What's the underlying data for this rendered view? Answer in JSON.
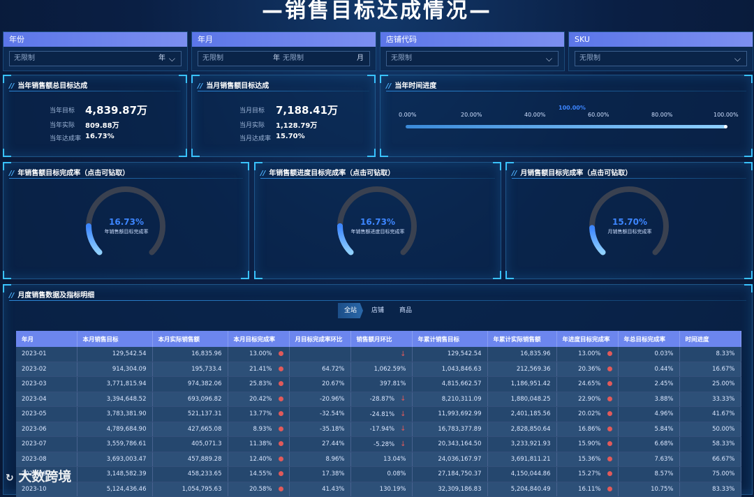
{
  "title": "—销售目标达成情况—",
  "filters": [
    {
      "label": "年份",
      "value": "无限制",
      "unit": "年"
    },
    {
      "label": "年月",
      "value": "无限制",
      "unit": "年",
      "value2": "无限制",
      "unit2": "月"
    },
    {
      "label": "店铺代码",
      "value": "无限制"
    },
    {
      "label": "SKU",
      "value": "无限制"
    }
  ],
  "kpi_year": {
    "title": "当年销售额总目标达成",
    "target_label": "当年目标",
    "target": "4,839.87万",
    "actual_label": "当年实际",
    "actual": "809.88万",
    "rate_label": "当年达成率",
    "rate": "16.73%"
  },
  "kpi_month": {
    "title": "当月销售额目标达成",
    "target_label": "当月目标",
    "target": "7,188.41万",
    "actual_label": "当月实际",
    "actual": "1,128.79万",
    "rate_label": "当月达成率",
    "rate": "15.70%"
  },
  "time_progress": {
    "title": "当年时间进度",
    "value": "100.00%",
    "value_fraction": 1.0,
    "ticks": [
      "0.00%",
      "20.00%",
      "40.00%",
      "60.00%",
      "80.00%",
      "100.00%"
    ]
  },
  "gauges": [
    {
      "title": "年销售额目标完成率（点击可钻取）",
      "value": "16.73%",
      "fraction": 0.1673,
      "caption": "年销售额目标完成率"
    },
    {
      "title": "年销售额进度目标完成率（点击可钻取）",
      "value": "16.73%",
      "fraction": 0.1673,
      "caption": "年销售额进度目标完成率"
    },
    {
      "title": "月销售额目标完成率（点击可钻取）",
      "value": "15.70%",
      "fraction": 0.157,
      "caption": "月销售额目标完成率"
    }
  ],
  "detail": {
    "title": "月度销售数据及指标明细",
    "tabs": [
      "全站",
      "店铺",
      "商品"
    ],
    "columns": [
      "年月",
      "本月销售目标",
      "本月实际销售额",
      "本月目标完成率",
      "月目标完成率环比",
      "销售额月环比",
      "年累计销售目标",
      "年累计实际销售额",
      "年进度目标完成率",
      "年总目标完成率",
      "时间进度"
    ],
    "rows": [
      {
        "ym": "2023-01",
        "target": "129,542.54",
        "actual": "16,835.96",
        "rate": "13.00%",
        "rate_mom": "",
        "sales_mom": "",
        "sales_down": true,
        "cum_target": "129,542.54",
        "cum_actual": "16,835.96",
        "prog_rate": "13.00%",
        "total_rate": "0.03%",
        "time": "8.33%"
      },
      {
        "ym": "2023-02",
        "target": "914,304.09",
        "actual": "195,733.4",
        "rate": "21.41%",
        "rate_mom": "64.72%",
        "sales_mom": "1,062.59%",
        "sales_down": false,
        "cum_target": "1,043,846.63",
        "cum_actual": "212,569.36",
        "prog_rate": "20.36%",
        "total_rate": "0.44%",
        "time": "16.67%"
      },
      {
        "ym": "2023-03",
        "target": "3,771,815.94",
        "actual": "974,382.06",
        "rate": "25.83%",
        "rate_mom": "20.67%",
        "sales_mom": "397.81%",
        "sales_down": false,
        "cum_target": "4,815,662.57",
        "cum_actual": "1,186,951.42",
        "prog_rate": "24.65%",
        "total_rate": "2.45%",
        "time": "25.00%"
      },
      {
        "ym": "2023-04",
        "target": "3,394,648.52",
        "actual": "693,096.82",
        "rate": "20.42%",
        "rate_mom": "-20.96%",
        "sales_mom": "-28.87%",
        "sales_down": true,
        "cum_target": "8,210,311.09",
        "cum_actual": "1,880,048.25",
        "prog_rate": "22.90%",
        "total_rate": "3.88%",
        "time": "33.33%"
      },
      {
        "ym": "2023-05",
        "target": "3,783,381.90",
        "actual": "521,137.31",
        "rate": "13.77%",
        "rate_mom": "-32.54%",
        "sales_mom": "-24.81%",
        "sales_down": true,
        "cum_target": "11,993,692.99",
        "cum_actual": "2,401,185.56",
        "prog_rate": "20.02%",
        "total_rate": "4.96%",
        "time": "41.67%"
      },
      {
        "ym": "2023-06",
        "target": "4,789,684.90",
        "actual": "427,665.08",
        "rate": "8.93%",
        "rate_mom": "-35.18%",
        "sales_mom": "-17.94%",
        "sales_down": true,
        "cum_target": "16,783,377.89",
        "cum_actual": "2,828,850.64",
        "prog_rate": "16.86%",
        "total_rate": "5.84%",
        "time": "50.00%"
      },
      {
        "ym": "2023-07",
        "target": "3,559,786.61",
        "actual": "405,071.3",
        "rate": "11.38%",
        "rate_mom": "27.44%",
        "sales_mom": "-5.28%",
        "sales_down": true,
        "cum_target": "20,343,164.50",
        "cum_actual": "3,233,921.93",
        "prog_rate": "15.90%",
        "total_rate": "6.68%",
        "time": "58.33%"
      },
      {
        "ym": "2023-08",
        "target": "3,693,003.47",
        "actual": "457,889.28",
        "rate": "12.40%",
        "rate_mom": "8.96%",
        "sales_mom": "13.04%",
        "sales_down": false,
        "cum_target": "24,036,167.97",
        "cum_actual": "3,691,811.21",
        "prog_rate": "15.36%",
        "total_rate": "7.63%",
        "time": "66.67%"
      },
      {
        "ym": "2023-09",
        "target": "3,148,582.39",
        "actual": "458,233.65",
        "rate": "14.55%",
        "rate_mom": "17.38%",
        "sales_mom": "0.08%",
        "sales_down": false,
        "cum_target": "27,184,750.37",
        "cum_actual": "4,150,044.86",
        "prog_rate": "15.27%",
        "total_rate": "8.57%",
        "time": "75.00%"
      },
      {
        "ym": "2023-10",
        "target": "5,124,436.46",
        "actual": "1,054,795.63",
        "rate": "20.58%",
        "rate_mom": "41.43%",
        "sales_mom": "130.19%",
        "sales_down": false,
        "cum_target": "32,309,186.83",
        "cum_actual": "5,204,840.49",
        "prog_rate": "16.11%",
        "total_rate": "10.75%",
        "time": "83.33%"
      }
    ]
  },
  "watermark": "大数跨境",
  "colors": {
    "accent": "#3d86ff",
    "header": "#6c86ee",
    "alert": "#e05a5a"
  }
}
